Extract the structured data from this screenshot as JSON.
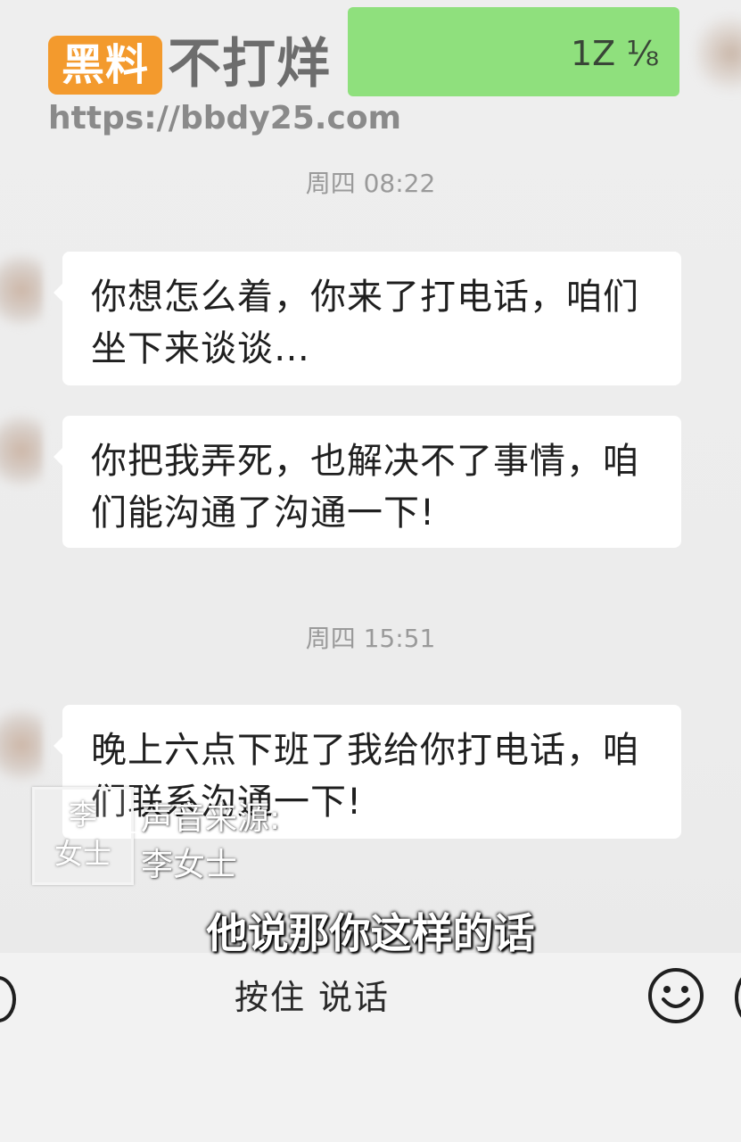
{
  "watermark": {
    "badge": "黑料",
    "text": "不打烊",
    "url": "https://bbdy25.com"
  },
  "sent_bubble": {
    "text": "1Z  ⅛"
  },
  "messages": [
    {
      "timestamp": "周四 08:22",
      "bubbles": [
        "你想怎么着，你来了打电话，咱们坐下来谈谈…",
        "你把我弄死，也解决不了事情，咱们能沟通了沟通一下!"
      ]
    },
    {
      "timestamp": "周四 15:51",
      "bubbles": [
        "晚上六点下班了我给你打电话，咱们联系沟通一下!"
      ]
    }
  ],
  "overlay": {
    "source_label": "声音来源:",
    "source_name": "李女士",
    "box_glyph": "李\n女士",
    "subtitle": "他说那你这样的话"
  },
  "input_bar": {
    "press_to_talk": "按住 说话",
    "emoji_icon": "emoji-face-icon",
    "voice_icon": "voice-icon",
    "plus_icon": "plus-icon"
  }
}
